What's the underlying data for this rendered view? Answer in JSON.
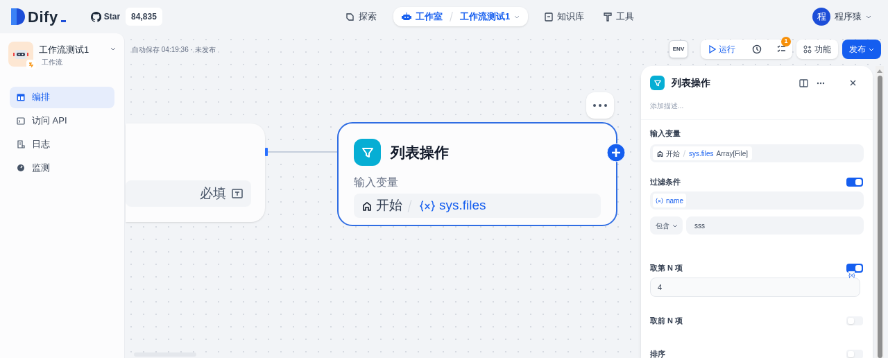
{
  "header": {
    "logo": "Dify",
    "star_label": "Star",
    "star_count": "84,835",
    "nav": [
      {
        "kind": "explore",
        "label": "探索",
        "selected": false
      },
      {
        "kind": "studio",
        "label": "工作室",
        "breadcrumb": "工作流测试1",
        "selected": true
      },
      {
        "kind": "knowledge",
        "label": "知识库",
        "selected": false
      },
      {
        "kind": "tools",
        "label": "工具",
        "selected": false
      }
    ],
    "user": {
      "initial": "程",
      "name": "程序猿"
    }
  },
  "sidebar": {
    "app_name": "工作流测试1",
    "app_type": "工作流",
    "items": [
      {
        "kind": "layout",
        "label": "编排",
        "selected": true
      },
      {
        "kind": "api",
        "label": "访问 API",
        "selected": false
      },
      {
        "kind": "log",
        "label": "日志",
        "selected": false
      },
      {
        "kind": "monitor",
        "label": "监测",
        "selected": false
      }
    ]
  },
  "toolbar": {
    "autosave": "自动保存 04:19:36 · 未发布",
    "env": "ENV",
    "run": "运行",
    "checklist_badge": "1",
    "features": "功能",
    "publish": "发布"
  },
  "canvas": {
    "start_node": {
      "required": "必填"
    },
    "node": {
      "title": "列表操作",
      "input_label": "输入变量",
      "source": "开始",
      "variable": "sys.files"
    }
  },
  "panel": {
    "title": "列表操作",
    "description_placeholder": "添加描述...",
    "sections": [
      {
        "kind": "variable",
        "label": "输入变量",
        "source": "开始",
        "variable": "sys.files",
        "type": "Array[File]"
      },
      {
        "kind": "filter",
        "label": "过滤条件",
        "on": true,
        "variable": "name",
        "operator": "包含",
        "value": "sss"
      },
      {
        "kind": "number",
        "label": "取第 N 项",
        "on": true,
        "value": "4",
        "hint": "{x}"
      },
      {
        "kind": "toggle",
        "label": "取前 N 项",
        "on": false
      },
      {
        "kind": "toggle",
        "label": "排序",
        "on": false
      }
    ]
  }
}
